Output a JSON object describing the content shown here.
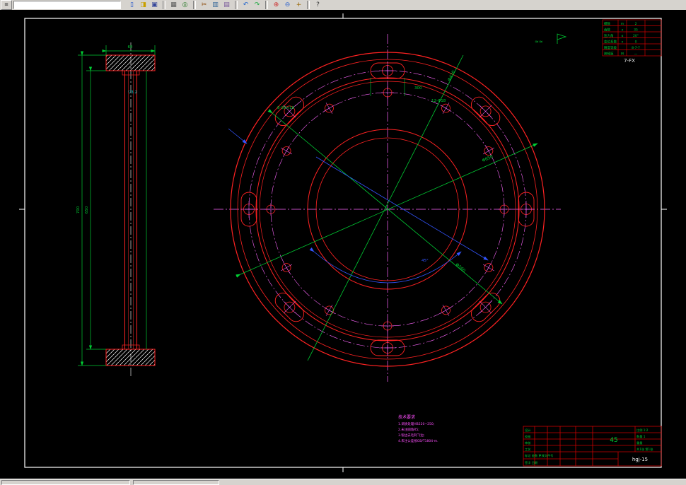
{
  "window": {
    "menu_glyph": "≡",
    "toolbar_icons": [
      {
        "name": "new-file",
        "glyph": "▯"
      },
      {
        "name": "open-file",
        "glyph": "◨"
      },
      {
        "name": "save",
        "glyph": "▣"
      },
      {
        "name": "print",
        "glyph": "▦"
      },
      {
        "name": "print-preview",
        "glyph": "◎"
      },
      {
        "name": "cut",
        "glyph": "✂"
      },
      {
        "name": "copy",
        "glyph": "▥"
      },
      {
        "name": "paste",
        "glyph": "▤"
      },
      {
        "name": "undo",
        "glyph": "↶"
      },
      {
        "name": "redo",
        "glyph": "↷"
      },
      {
        "name": "zoom-in",
        "glyph": "⊕"
      },
      {
        "name": "zoom-out",
        "glyph": "⊖"
      },
      {
        "name": "pan",
        "glyph": "+"
      },
      {
        "name": "help",
        "glyph": "?"
      }
    ]
  },
  "param_table": {
    "title": "7-FX",
    "rows": [
      {
        "l": "模数",
        "s": "m",
        "v": "2"
      },
      {
        "l": "齿数",
        "s": "z",
        "v": "35"
      },
      {
        "l": "压力角",
        "s": "α",
        "v": "20°"
      },
      {
        "l": "变位系数",
        "s": "x",
        "v": "0"
      },
      {
        "l": "精度等级",
        "s": "",
        "v": "8-7-7"
      },
      {
        "l": "跨棒距",
        "s": "M",
        "v": "—"
      }
    ],
    "marks": "≈≈"
  },
  "title_block": {
    "material": "45",
    "part_no": "hgj-15",
    "left_rows": [
      "设计",
      "校核",
      "审核",
      "工艺"
    ],
    "row_marks": "标记 处数 更改文件号",
    "row_sign": "签字  日期",
    "scale": "比例 1:2",
    "qty": "数量 1",
    "weight": "重量",
    "sheet": "共1张 第1张"
  },
  "notes": {
    "heading": "技术要求",
    "lines": [
      "1.调质处理HB220~250;",
      "2.未注圆角R5;",
      "3.锐边去毛刺飞边;",
      "4.未注公差按GB/T1804-m."
    ]
  },
  "dims": {
    "front_d1": "Φ650",
    "front_d2": "Φ560",
    "front_d3": "Φ420",
    "holes": "12-Φ18",
    "slots": "8-36×18",
    "angle": "45°",
    "slot_span": "300",
    "side_w": "60",
    "side_h": "650",
    "side_total": "700",
    "finish": "▽3.2"
  },
  "colors": {
    "geometry": "#ff2222",
    "dimension": "#00cc33",
    "centerline": "#ff66ff",
    "leader": "#3355ff",
    "notes": "#ff4fff",
    "finish": "#00cccc"
  }
}
